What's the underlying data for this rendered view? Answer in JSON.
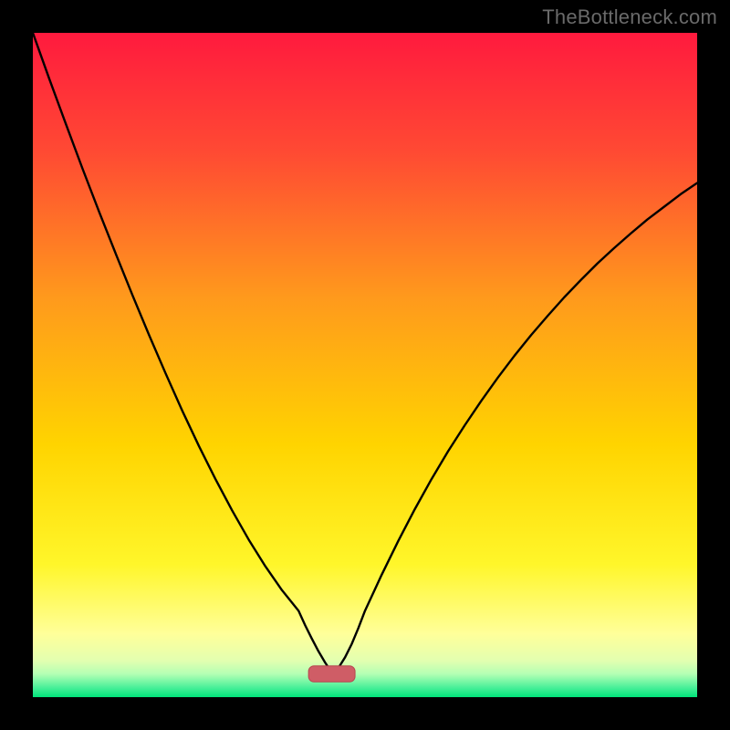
{
  "watermark": "TheBottleneck.com",
  "colors": {
    "frame": "#000000",
    "curve": "#000000",
    "marker_fill": "#cf5d66",
    "marker_stroke": "#b7454e",
    "gradient_stops": [
      {
        "offset": 0.0,
        "color": "#ff1a3e"
      },
      {
        "offset": 0.18,
        "color": "#ff4a33"
      },
      {
        "offset": 0.4,
        "color": "#ff9a1c"
      },
      {
        "offset": 0.62,
        "color": "#ffd400"
      },
      {
        "offset": 0.8,
        "color": "#fff62a"
      },
      {
        "offset": 0.905,
        "color": "#ffff9a"
      },
      {
        "offset": 0.945,
        "color": "#e3ffb0"
      },
      {
        "offset": 0.965,
        "color": "#b4ffb4"
      },
      {
        "offset": 0.985,
        "color": "#4cf09a"
      },
      {
        "offset": 1.0,
        "color": "#00e57a"
      }
    ]
  },
  "chart_data": {
    "type": "line",
    "title": "",
    "xlabel": "",
    "ylabel": "",
    "xlim": [
      0,
      1
    ],
    "ylim": [
      0,
      1
    ],
    "grid": false,
    "legend": false,
    "x": [
      0.0,
      0.025,
      0.05,
      0.075,
      0.1,
      0.125,
      0.15,
      0.175,
      0.2,
      0.225,
      0.25,
      0.275,
      0.3,
      0.325,
      0.35,
      0.375,
      0.4,
      0.41,
      0.42,
      0.43,
      0.44,
      0.45,
      0.46,
      0.47,
      0.48,
      0.49,
      0.5,
      0.525,
      0.55,
      0.575,
      0.6,
      0.625,
      0.65,
      0.675,
      0.7,
      0.725,
      0.75,
      0.775,
      0.8,
      0.825,
      0.85,
      0.875,
      0.9,
      0.925,
      0.95,
      0.975,
      1.0
    ],
    "series": [
      {
        "name": "curve",
        "values": [
          1.0,
          0.93,
          0.862,
          0.795,
          0.73,
          0.667,
          0.605,
          0.545,
          0.487,
          0.431,
          0.378,
          0.328,
          0.281,
          0.237,
          0.197,
          0.161,
          0.13,
          0.108,
          0.088,
          0.069,
          0.052,
          0.037,
          0.044,
          0.06,
          0.08,
          0.104,
          0.13,
          0.184,
          0.235,
          0.283,
          0.328,
          0.37,
          0.409,
          0.446,
          0.481,
          0.514,
          0.545,
          0.574,
          0.602,
          0.628,
          0.653,
          0.676,
          0.698,
          0.719,
          0.738,
          0.757,
          0.774
        ]
      }
    ],
    "marker": {
      "x": 0.45,
      "y": 0.035,
      "rx": 0.035,
      "ry": 0.012
    },
    "notes": "Values are normalized to the plot area (0..1 on each axis). The curve descends from top-left to a cusp near x≈0.45, y≈0.035, then rises toward the right edge at y≈0.77. Background is a vertical red→orange→yellow→green gradient. A small rounded rectangle marker sits at the cusp."
  }
}
